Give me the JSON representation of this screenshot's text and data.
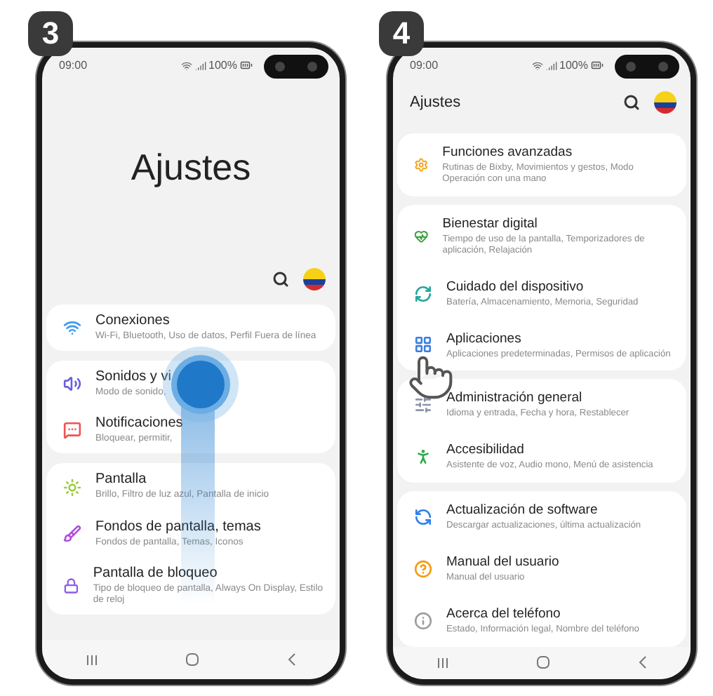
{
  "phones": [
    {
      "step": "3",
      "time": "09:00",
      "battery": "100%",
      "header": {
        "kind": "large",
        "title": "Ajustes"
      },
      "gesture": {
        "kind": "swipe"
      },
      "groups": [
        [
          {
            "title": "Conexiones",
            "subtitle": "Wi-Fi, Bluetooth, Uso de datos, Perfil Fuera de línea",
            "color": "#3b9cf0"
          }
        ],
        [
          {
            "title": "Sonidos y vi",
            "subtitle": "Modo de sonido,",
            "color": "#6b5fe0"
          },
          {
            "title": "Notificaciones",
            "subtitle": "Bloquear, permitir,",
            "color": "#ef5350"
          }
        ],
        [
          {
            "title": "Pantalla",
            "subtitle": "Brillo, Filtro de luz azul, Pantalla de inicio",
            "color": "#9ccc3c"
          },
          {
            "title": "Fondos de pantalla, temas",
            "subtitle": "Fondos de pantalla, Temas, Iconos",
            "color": "#b04fd8"
          },
          {
            "title": "Pantalla de bloqueo",
            "subtitle": "Tipo de bloqueo de pantalla, Always On Display, Estilo de reloj",
            "color": "#8c5ee8"
          }
        ]
      ]
    },
    {
      "step": "4",
      "time": "09:00",
      "battery": "100%",
      "header": {
        "kind": "compact",
        "title": "Ajustes"
      },
      "gesture": {
        "kind": "tap"
      },
      "groups": [
        [
          {
            "title": "Funciones avanzadas",
            "subtitle": "Rutinas de Bixby, Movimientos y gestos, Modo Operación con una mano",
            "color": "#f5a623"
          }
        ],
        [
          {
            "title": "Bienestar digital",
            "subtitle": "Tiempo de uso de la pantalla, Temporizadores de aplicación, Relajación",
            "color": "#43a047"
          },
          {
            "title": "Cuidado del dispositivo",
            "subtitle": "Batería, Almacenamiento, Memoria, Seguridad",
            "color": "#26a69a"
          },
          {
            "title": "Aplicaciones",
            "subtitle": "Aplicaciones predeterminadas, Permisos de aplicación",
            "color": "#3b7de0"
          }
        ],
        [
          {
            "title": "Administración general",
            "subtitle": "Idioma y entrada, Fecha y hora, Restablecer",
            "color": "#8a94a6"
          },
          {
            "title": "Accesibilidad",
            "subtitle": "Asistente de voz, Audio mono, Menú de asistencia",
            "color": "#2eaa4a"
          }
        ],
        [
          {
            "title": "Actualización de software",
            "subtitle": "Descargar actualizaciones, última actualización",
            "color": "#2f80ed"
          },
          {
            "title": "Manual del usuario",
            "subtitle": "Manual del usuario",
            "color": "#f39c12"
          },
          {
            "title": "Acerca del teléfono",
            "subtitle": "Estado, Información legal, Nombre del teléfono",
            "color": "#9e9e9e"
          }
        ]
      ]
    }
  ]
}
